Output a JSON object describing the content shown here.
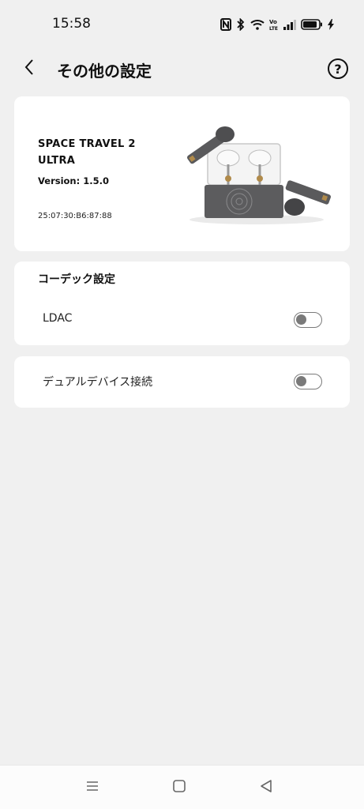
{
  "status_bar": {
    "time": "15:58",
    "icons": [
      "nfc-icon",
      "bluetooth-icon",
      "wifi-icon",
      "volte-icon",
      "signal-icon",
      "battery-icon",
      "charging-icon"
    ]
  },
  "header": {
    "back_icon": "chevron-left-icon",
    "title": "その他の設定",
    "help_icon": "question-circle-icon",
    "help_glyph": "?"
  },
  "device": {
    "name": "SPACE TRAVEL 2 ULTRA",
    "version": "Version: 1.5.0",
    "mac": "25:07:30:B6:87:88",
    "image": "earbuds-case-image"
  },
  "codec": {
    "title": "コーデック設定",
    "ldac_label": "LDAC",
    "ldac_enabled": false
  },
  "dual_device": {
    "label": "デュアルデバイス接続",
    "enabled": false
  },
  "nav_bar": {
    "items": [
      "menu-icon",
      "home-icon",
      "back-icon"
    ]
  },
  "colors": {
    "background": "#f0f0f0",
    "card": "#ffffff",
    "toggle_off": "#7a7a7a"
  }
}
